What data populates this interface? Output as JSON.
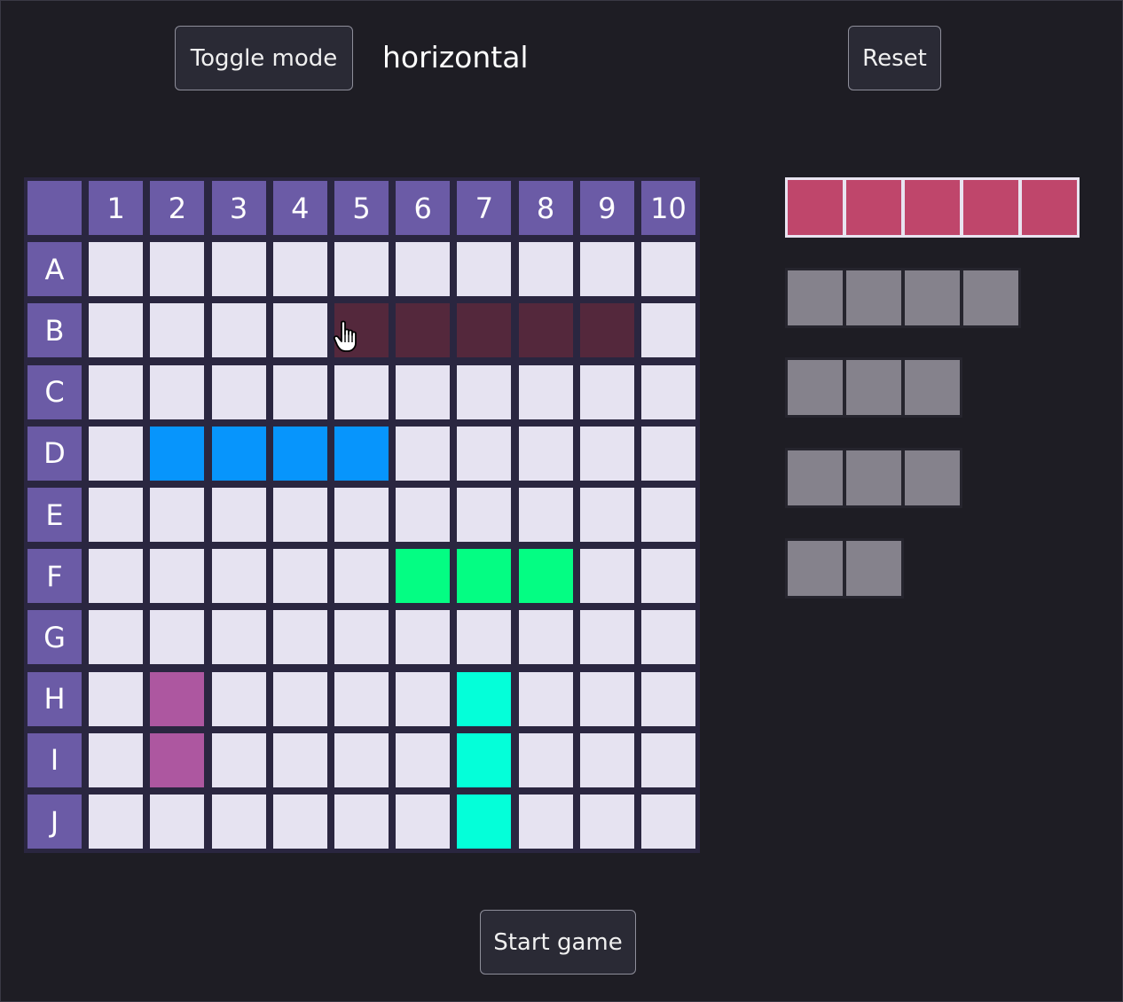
{
  "controls": {
    "toggle_label": "Toggle mode",
    "mode_value": "horizontal",
    "reset_label": "Reset",
    "start_label": "Start game"
  },
  "board": {
    "columns": [
      "1",
      "2",
      "3",
      "4",
      "5",
      "6",
      "7",
      "8",
      "9",
      "10"
    ],
    "rows": [
      "A",
      "B",
      "C",
      "D",
      "E",
      "F",
      "G",
      "H",
      "I",
      "J"
    ],
    "colors": {
      "empty": "#e6e3f1",
      "header": "#6b5ba6",
      "preview": "#54283c"
    },
    "placed_ships": [
      {
        "color": "#0795fc",
        "cells": [
          "D2",
          "D3",
          "D4",
          "D5"
        ]
      },
      {
        "color": "#04fd83",
        "cells": [
          "F6",
          "F7",
          "F8"
        ]
      },
      {
        "color": "#04ffd9",
        "cells": [
          "H7",
          "I7",
          "J7"
        ]
      },
      {
        "color": "#ad57a0",
        "cells": [
          "H2",
          "I2"
        ]
      }
    ],
    "preview_cells": [
      "B5",
      "B6",
      "B7",
      "B8",
      "B9"
    ]
  },
  "ship_tray": [
    {
      "length": 5,
      "selected": true
    },
    {
      "length": 4,
      "selected": false
    },
    {
      "length": 3,
      "selected": false
    },
    {
      "length": 3,
      "selected": false
    },
    {
      "length": 2,
      "selected": false
    }
  ],
  "cursor": {
    "icon": "pointer-hand-icon"
  }
}
